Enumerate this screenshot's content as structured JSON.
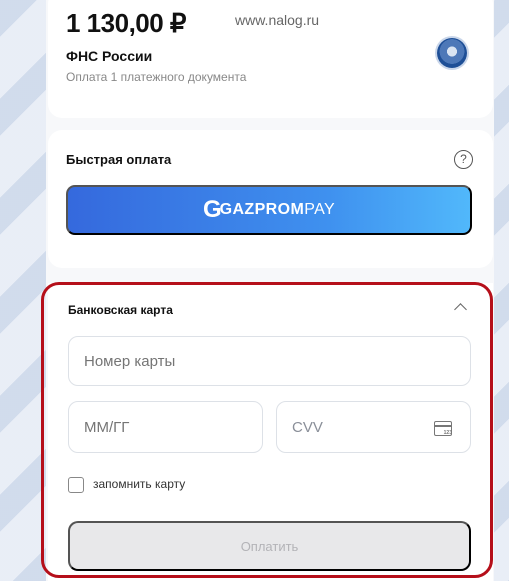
{
  "payment_summary": {
    "amount": "1 130,00 ₽",
    "website": "www.nalog.ru",
    "payee": "ФНС России",
    "description": "Оплата 1 платежного документа",
    "emblem_icon": "tax-service-emblem-icon"
  },
  "quick_payment": {
    "title": "Быстрая оплата",
    "help_symbol": "?",
    "gazprompay_mark": "G",
    "gazprompay_brand": "GAZPROM",
    "gazprompay_suffix": "PAY"
  },
  "bank_card": {
    "title": "Банковская карта",
    "collapse_icon": "chevron-up-icon",
    "card_number_placeholder": "Номер карты",
    "expiry_placeholder": "ММ/ГГ",
    "cvv_placeholder": "CVV",
    "cvv_icon": "card-cvv-icon",
    "remember_card_label": "запомнить карту",
    "pay_button_label": "Оплатить"
  },
  "colors": {
    "primary_blue": "#3569dd",
    "accent_red": "#b50f1a",
    "disabled_gray": "#e8e8ea"
  }
}
